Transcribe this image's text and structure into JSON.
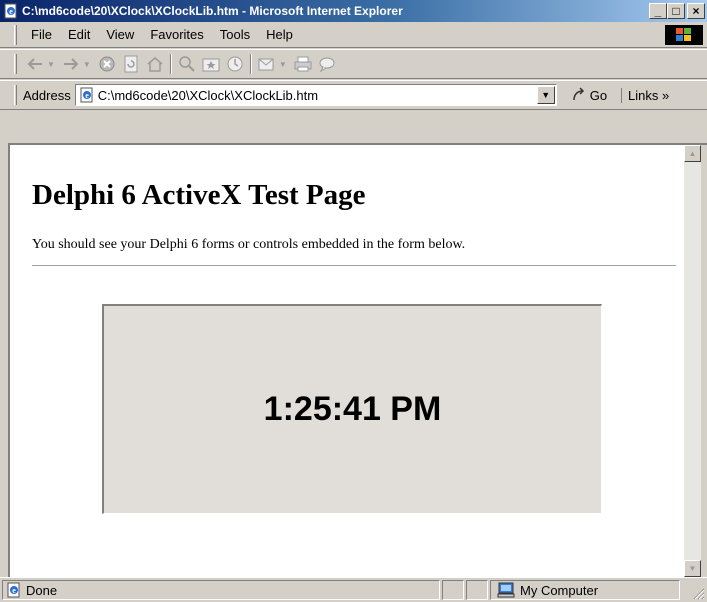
{
  "window": {
    "title": "C:\\md6code\\20\\XClock\\XClockLib.htm - Microsoft Internet Explorer",
    "minimize": "_",
    "maximize": "□",
    "close": "×"
  },
  "menu": {
    "items": [
      "File",
      "Edit",
      "View",
      "Favorites",
      "Tools",
      "Help"
    ]
  },
  "address": {
    "label": "Address",
    "url": "C:\\md6code\\20\\XClock\\XClockLib.htm",
    "go_label": "Go",
    "links_label": "Links »"
  },
  "page": {
    "heading": "Delphi 6 ActiveX Test Page",
    "intro": "You should see your Delphi 6 forms or controls embedded in the form below.",
    "clock_time": "1:25:41 PM"
  },
  "status": {
    "text": "Done",
    "zone": "My Computer"
  },
  "colors": {
    "titlebar_start": "#0a246a",
    "titlebar_end": "#a6caf0",
    "chrome": "#d4d0c8",
    "activex_bg": "#e1ddd9"
  }
}
